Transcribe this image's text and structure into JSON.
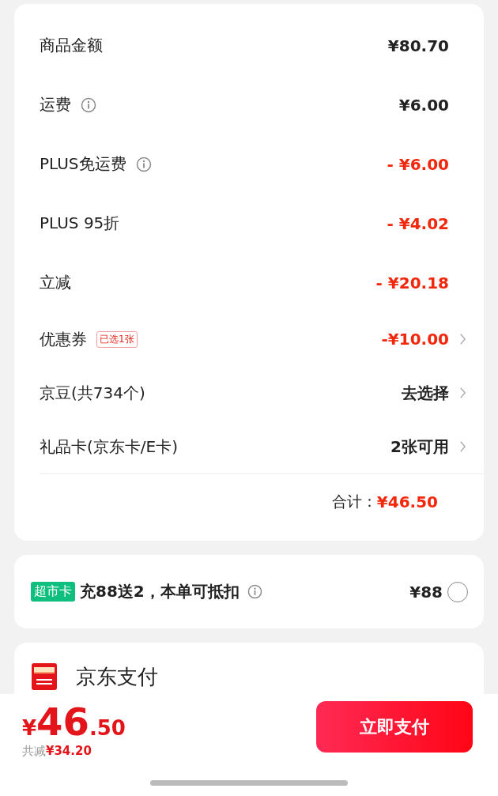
{
  "summary": {
    "rows": [
      {
        "label": "商品金额",
        "info": false,
        "value": "¥80.70",
        "kind": "normal",
        "arrow": false
      },
      {
        "label": "运费",
        "info": true,
        "value": "¥6.00",
        "kind": "normal",
        "arrow": false
      },
      {
        "label": "PLUS免运费",
        "info": true,
        "value": "- ¥6.00",
        "kind": "discount",
        "arrow": false
      },
      {
        "label": "PLUS 95折",
        "info": false,
        "value": "- ¥4.02",
        "kind": "discount",
        "arrow": false
      },
      {
        "label": "立减",
        "info": false,
        "value": "- ¥20.18",
        "kind": "discount",
        "arrow": false
      },
      {
        "label": "优惠券",
        "info": false,
        "tag": "已选1张",
        "value": "-¥10.00",
        "kind": "discount",
        "arrow": true
      },
      {
        "label": "京豆(共734个)",
        "info": false,
        "value": "去选择",
        "kind": "normal",
        "arrow": true
      },
      {
        "label": "礼品卡(京东卡/E卡)",
        "info": false,
        "value": "2张可用",
        "kind": "normal",
        "arrow": true
      }
    ],
    "total_label": "合计：",
    "total_value": "¥46.50"
  },
  "card_offer": {
    "badge": "超市卡",
    "text": "充88送2，本单可抵扣",
    "price": "¥88",
    "selected": false
  },
  "payment": {
    "method": "京东支付"
  },
  "bottom_bar": {
    "currency": "¥",
    "price_int": "46",
    "price_dec": ".50",
    "saved_label": "共减",
    "saved_value": "¥34.20",
    "pay_button": "立即支付"
  }
}
